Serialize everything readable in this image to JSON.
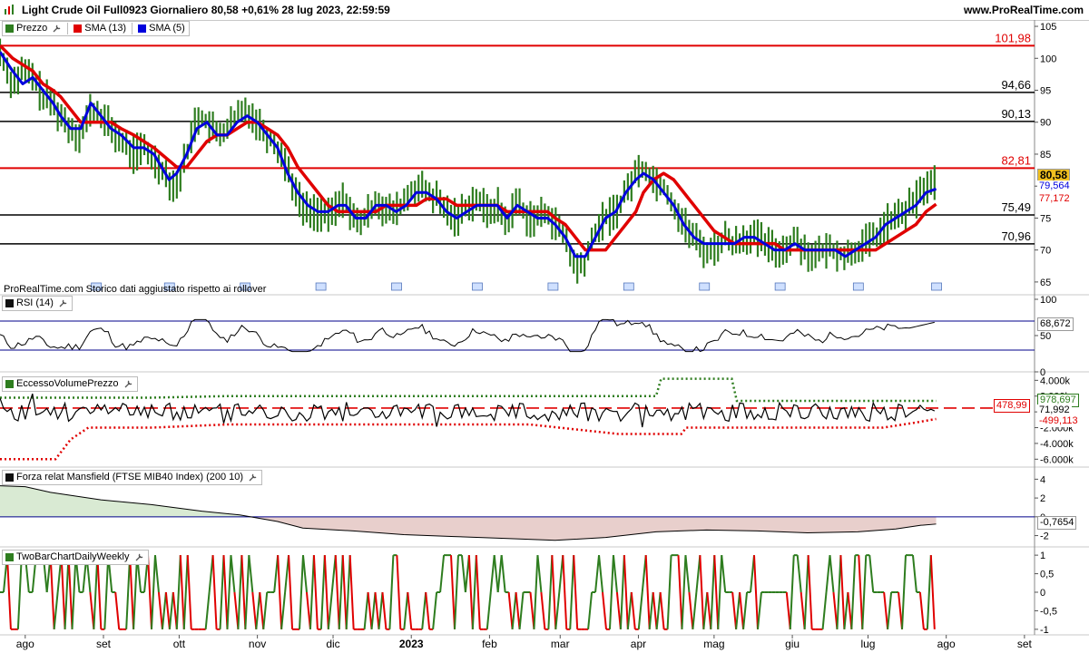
{
  "header": {
    "title": "Light Crude Oil Full0923 Giornaliero 80,58 +0,61% 28 lug 2023, 22:59:59",
    "site": "www.ProRealTime.com"
  },
  "colors": {
    "green": "#2e7d1f",
    "red": "#e00000",
    "blue": "#0000dd",
    "grid": "#000000"
  },
  "x_axis": {
    "labels": [
      {
        "label": "ago",
        "day": 10
      },
      {
        "label": "set",
        "day": 41
      },
      {
        "label": "ott",
        "day": 71
      },
      {
        "label": "nov",
        "day": 102
      },
      {
        "label": "dic",
        "day": 132
      },
      {
        "label": "2023",
        "day": 163
      },
      {
        "label": "feb",
        "day": 194
      },
      {
        "label": "mar",
        "day": 222
      },
      {
        "label": "apr",
        "day": 253
      },
      {
        "label": "mag",
        "day": 283
      },
      {
        "label": "giu",
        "day": 314
      },
      {
        "label": "lug",
        "day": 344
      },
      {
        "label": "ago",
        "day": 375
      },
      {
        "label": "set",
        "day": 406
      }
    ]
  },
  "price_panel": {
    "legend": [
      {
        "name": "Prezzo",
        "color": "#2e7d1f"
      },
      {
        "name": "SMA (13)",
        "color": "#e00000"
      },
      {
        "name": "SMA (5)",
        "color": "#0000dd"
      }
    ],
    "footnote": "ProRealTime.com  Storico dati aggiustato rispetto ai rollover",
    "y_ticks": [
      "105",
      "100",
      "95",
      "90",
      "85",
      "80",
      "75",
      "70",
      "65"
    ],
    "levels": [
      {
        "value": 101.98,
        "label": "101,98",
        "color": "#e00000"
      },
      {
        "value": 94.66,
        "label": "94,66",
        "color": "#000000"
      },
      {
        "value": 90.13,
        "label": "90,13",
        "color": "#000000"
      },
      {
        "value": 82.81,
        "label": "82,81",
        "color": "#e00000"
      },
      {
        "value": 75.49,
        "label": "75,49",
        "color": "#000000"
      },
      {
        "value": 70.96,
        "label": "70,96",
        "color": "#000000"
      }
    ],
    "last_price": "80,58",
    "sma5_last": "79,564",
    "sma13_last": "77,172"
  },
  "rsi_panel": {
    "legend": "RSI (14)",
    "y_ticks": [
      "100",
      "50",
      "0"
    ],
    "last": "68,672"
  },
  "evp_panel": {
    "legend": "EccessoVolumePrezzo",
    "y_ticks": [
      "4.000k",
      "2.000k",
      "0",
      "-2.000k",
      "-4.000k",
      "-6.000k"
    ],
    "upper": "978,697",
    "mid": "71,992",
    "lower": "-499,113",
    "level_tag": "478,99"
  },
  "mansfield_panel": {
    "legend": "Forza relat Mansfield (FTSE MIB40 Index) (200 10)",
    "y_ticks": [
      "4",
      "2",
      "0",
      "-2"
    ],
    "last": "-0,7654"
  },
  "twobar_panel": {
    "legend": "TwoBarChartDailyWeekly",
    "y_ticks": [
      "1",
      "0,5",
      "0",
      "-0,5",
      "-1"
    ]
  },
  "chart_data": [
    {
      "type": "line",
      "title": "Light Crude Oil Full0923 Giornaliero",
      "x_unit": "days since start",
      "series": [
        {
          "name": "Prezzo",
          "x": [
            0,
            5,
            9,
            13,
            17,
            21,
            24,
            28,
            32,
            36,
            40,
            44,
            48,
            53,
            57,
            61,
            64,
            67,
            70,
            74,
            78,
            82,
            86,
            90,
            94,
            98,
            102,
            106,
            110,
            114,
            118,
            122,
            126,
            130,
            134,
            137,
            141,
            145,
            149,
            153,
            157,
            161,
            165,
            169,
            173,
            177,
            181,
            185,
            189,
            193,
            197,
            201,
            205,
            209,
            213,
            217,
            220,
            224,
            228,
            232,
            236,
            240,
            244,
            248,
            252,
            255,
            259,
            263,
            267,
            271,
            275,
            279,
            283,
            287,
            291,
            295,
            299,
            303,
            307,
            311,
            315,
            319,
            323,
            327,
            331,
            335,
            339,
            343,
            347,
            351,
            355,
            359,
            363,
            367,
            371
          ],
          "values": [
            101,
            96,
            98,
            97,
            94,
            93,
            91,
            89,
            88,
            92,
            91,
            89,
            87,
            85,
            86,
            84,
            83,
            81,
            80,
            85,
            91,
            90,
            88,
            89,
            91,
            92,
            90,
            88,
            86,
            83,
            78,
            76,
            76,
            75,
            77,
            78,
            74,
            75,
            78,
            76,
            76,
            78,
            80,
            79,
            78,
            76,
            75,
            77,
            78,
            76,
            77,
            74,
            78,
            75,
            75,
            76,
            74,
            72,
            67,
            68,
            73,
            75,
            76,
            79,
            82,
            83,
            81,
            80,
            77,
            74,
            72,
            70,
            70,
            72,
            71,
            72,
            72,
            71,
            70,
            70,
            72,
            70,
            69,
            70,
            70,
            69,
            70,
            71,
            72,
            74,
            75,
            76,
            78,
            80,
            80.58
          ]
        },
        {
          "name": "SMA (13)",
          "x": [
            0,
            5,
            9,
            13,
            17,
            21,
            24,
            28,
            32,
            36,
            40,
            44,
            48,
            53,
            57,
            61,
            64,
            67,
            70,
            74,
            78,
            82,
            86,
            90,
            94,
            98,
            102,
            106,
            110,
            114,
            118,
            122,
            126,
            130,
            134,
            137,
            141,
            145,
            149,
            153,
            157,
            161,
            165,
            169,
            173,
            177,
            181,
            185,
            189,
            193,
            197,
            201,
            205,
            209,
            213,
            217,
            220,
            224,
            228,
            232,
            236,
            240,
            244,
            248,
            252,
            255,
            259,
            263,
            267,
            271,
            275,
            279,
            283,
            287,
            291,
            295,
            299,
            303,
            307,
            311,
            315,
            319,
            323,
            327,
            331,
            335,
            339,
            343,
            347,
            351,
            355,
            359,
            363,
            367,
            371
          ],
          "values": [
            102,
            100,
            99,
            98,
            96,
            95,
            94,
            92,
            90,
            90,
            90,
            90,
            89,
            88,
            87,
            86,
            85,
            84,
            83,
            83,
            85,
            87,
            88,
            88,
            89,
            90,
            90,
            89,
            88,
            86,
            83,
            81,
            79,
            77,
            76,
            76,
            76,
            76,
            76,
            77,
            77,
            77,
            77,
            78,
            78,
            78,
            77,
            77,
            77,
            77,
            77,
            76,
            76,
            76,
            76,
            76,
            75,
            74,
            72,
            70,
            70,
            70,
            72,
            74,
            76,
            79,
            81,
            82,
            81,
            79,
            77,
            75,
            73,
            72,
            71,
            71,
            71,
            71,
            71,
            70,
            70,
            70,
            70,
            70,
            70,
            70,
            70,
            70,
            70,
            71,
            72,
            73,
            74,
            76,
            77.17
          ]
        },
        {
          "name": "SMA (5)",
          "x": [
            0,
            5,
            9,
            13,
            17,
            21,
            24,
            28,
            32,
            36,
            40,
            44,
            48,
            53,
            57,
            61,
            64,
            67,
            70,
            74,
            78,
            82,
            86,
            90,
            94,
            98,
            102,
            106,
            110,
            114,
            118,
            122,
            126,
            130,
            134,
            137,
            141,
            145,
            149,
            153,
            157,
            161,
            165,
            169,
            173,
            177,
            181,
            185,
            189,
            193,
            197,
            201,
            205,
            209,
            213,
            217,
            220,
            224,
            228,
            232,
            236,
            240,
            244,
            248,
            252,
            255,
            259,
            263,
            267,
            271,
            275,
            279,
            283,
            287,
            291,
            295,
            299,
            303,
            307,
            311,
            315,
            319,
            323,
            327,
            331,
            335,
            339,
            343,
            347,
            351,
            355,
            359,
            363,
            367,
            371
          ],
          "values": [
            101,
            98,
            96,
            97,
            95,
            93,
            91,
            89,
            89,
            93,
            91,
            89,
            88,
            86,
            86,
            85,
            83,
            81,
            82,
            85,
            89,
            90,
            88,
            88,
            90,
            91,
            90,
            88,
            86,
            82,
            79,
            77,
            76,
            76,
            77,
            77,
            75,
            75,
            77,
            77,
            76,
            77,
            79,
            79,
            78,
            76,
            75,
            76,
            77,
            77,
            77,
            75,
            77,
            76,
            75,
            75,
            74,
            72,
            69,
            69,
            72,
            75,
            76,
            79,
            81,
            82,
            81,
            79,
            77,
            74,
            72,
            71,
            71,
            71,
            71,
            72,
            72,
            71,
            70,
            70,
            71,
            70,
            70,
            70,
            70,
            69,
            70,
            71,
            72,
            74,
            75,
            76,
            77,
            79,
            79.56
          ]
        }
      ],
      "ylim": [
        63,
        106
      ]
    }
  ]
}
